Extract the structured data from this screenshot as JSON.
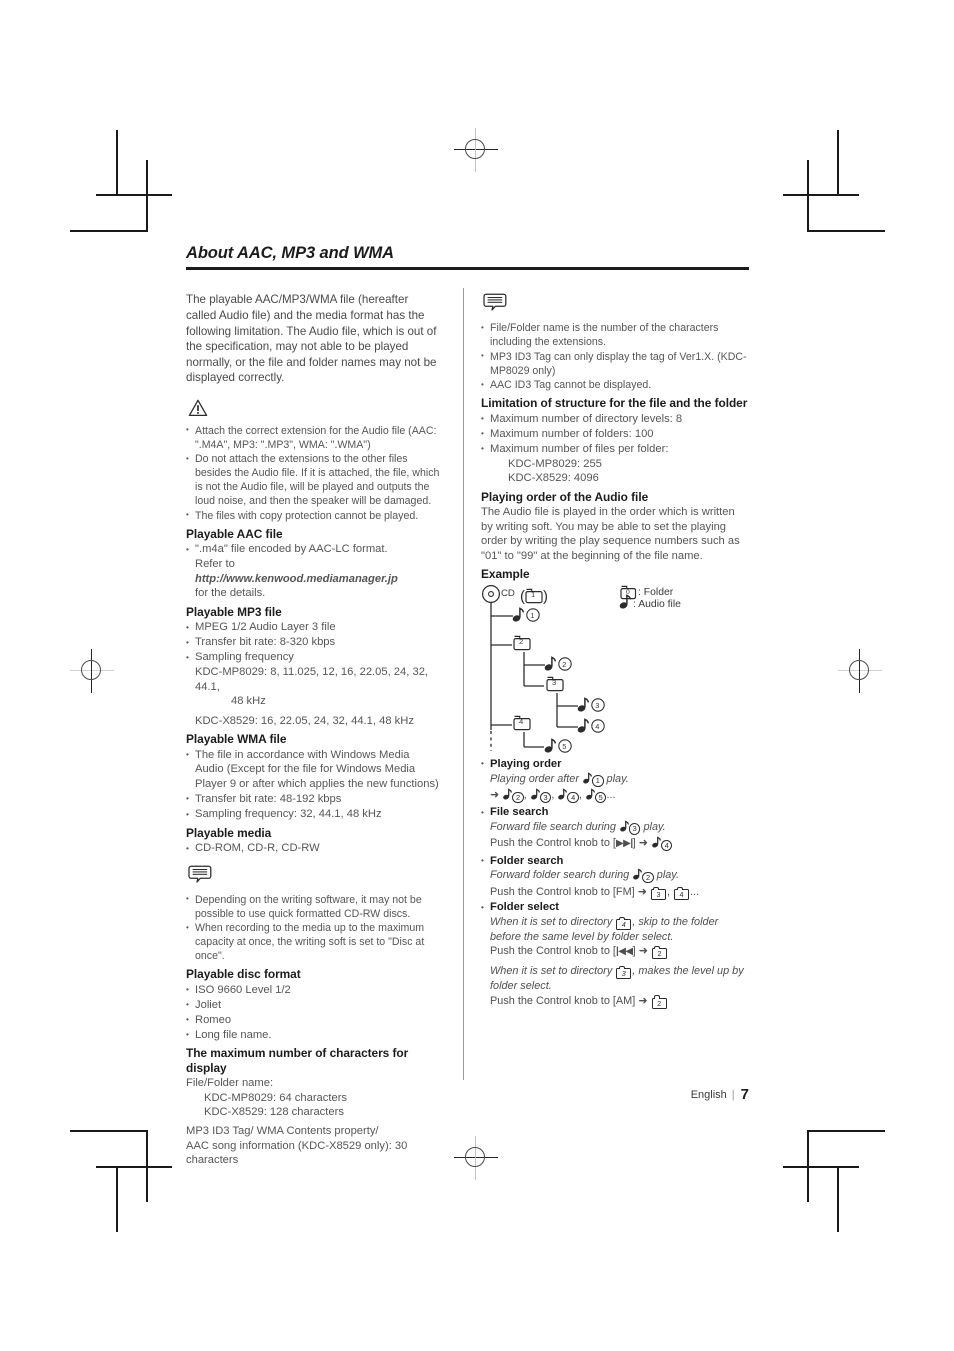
{
  "page": {
    "chapter_title": "About AAC, MP3 and WMA",
    "footer_language": "English",
    "footer_separator": "|",
    "footer_page_number": "7"
  },
  "left_column": {
    "intro": "The playable AAC/MP3/WMA file (hereafter called Audio file) and the media format has the following limitation. The Audio file, which is out of the specification, may not able to be played normally, or the file and folder names may not be displayed correctly.",
    "warning_icon": "warning-triangle-icon",
    "warning_items": [
      "Attach the correct extension for the Audio file (AAC: \".M4A\", MP3: \".MP3\", WMA: \".WMA\")",
      "Do not attach the extensions to the other files besides the Audio file. If it is attached, the file, which is not the Audio file, will be played and outputs the loud noise, and then the speaker will be damaged.",
      "The files with copy protection cannot be played."
    ],
    "aac": {
      "heading": "Playable AAC file",
      "bullet_lead": "\".m4a\" file encoded by AAC-LC format.",
      "refer_prefix": "Refer to ",
      "refer_url": "http://www.kenwood.mediamanager.jp",
      "refer_suffix": "for the details."
    },
    "mp3": {
      "heading": "Playable MP3 file",
      "items": [
        "MPEG 1/2 Audio Layer 3 file",
        "Transfer bit rate: 8-320 kbps",
        "Sampling frequency"
      ],
      "freq_line_1": "KDC-MP8029: 8, 11.025, 12, 16, 22.05, 24, 32, 44.1,",
      "freq_line_2": "48 kHz",
      "freq_line_3": "KDC-X8529: 16, 22.05, 24, 32, 44.1, 48 kHz"
    },
    "wma": {
      "heading": "Playable WMA file",
      "items": [
        "The file in accordance with Windows Media Audio (Except for the file for Windows Media Player 9 or after which applies the new functions)",
        "Transfer bit rate: 48-192 kbps",
        "Sampling frequency: 32, 44.1, 48 kHz"
      ]
    },
    "media": {
      "heading": "Playable media",
      "items": [
        "CD-ROM, CD-R, CD-RW"
      ]
    },
    "note_icon": "note-bubble-icon",
    "note_items": [
      "Depending on the writing software, it may not be possible to use quick formatted CD-RW discs.",
      "When recording to the media up to the maximum capacity at once, the writing soft is set to \"Disc at once\"."
    ],
    "disc_format": {
      "heading": "Playable disc format",
      "items": [
        "ISO 9660 Level 1/2",
        "Joliet",
        "Romeo",
        "Long file name."
      ]
    },
    "max_chars": {
      "heading": "The maximum number of characters for display",
      "line_1": "File/Folder name:",
      "indented_1": "KDC-MP8029: 64 characters",
      "indented_2": "KDC-X8529: 128 characters",
      "line_2": "MP3 ID3 Tag/ WMA Contents property/",
      "line_3": "AAC song information (KDC-X8529 only): 30",
      "line_4": "characters"
    }
  },
  "right_column": {
    "note_icon": "note-bubble-icon",
    "note_items": [
      "File/Folder name is the number of the characters including the extensions.",
      "MP3 ID3 Tag can only display the tag of Ver1.X. (KDC-MP8029 only)",
      "AAC ID3 Tag cannot be displayed."
    ],
    "limitation": {
      "heading": "Limitation of structure for the file and the folder",
      "items": [
        "Maximum number of directory levels: 8",
        "Maximum number of folders: 100",
        "Maximum number of files per folder:"
      ],
      "indented_1": "KDC-MP8029: 255",
      "indented_2": "KDC-X8529: 4096"
    },
    "playing_order": {
      "heading": "Playing order of the Audio file",
      "body": "The Audio file is played in the order which is written by writing soft. You may be able to set the playing order by writing the play sequence numbers such as \"01\" to \"99\" at the beginning of the file name.",
      "example_heading": "Example"
    },
    "diagram": {
      "root_label": "CD",
      "root_folder_number": "1",
      "legend_folder_number": "0",
      "legend_folder_text": ": Folder",
      "legend_audio_text": ": Audio file",
      "nodes": [
        {
          "kind": "audio",
          "number": "1"
        },
        {
          "kind": "folder",
          "number": "2"
        },
        {
          "kind": "audio",
          "number": "2"
        },
        {
          "kind": "folder",
          "number": "3"
        },
        {
          "kind": "audio",
          "number": "3"
        },
        {
          "kind": "audio",
          "number": "4"
        },
        {
          "kind": "folder",
          "number": "4"
        },
        {
          "kind": "audio",
          "number": "5"
        }
      ]
    },
    "operations": [
      {
        "title": "Playing order",
        "line_1_a": "Playing order after ",
        "line_1_num": "1",
        "line_1_b": " play.",
        "line_2_arrow": "➜",
        "line_2_nums": [
          "2",
          "3",
          "4",
          "5"
        ],
        "line_2_tail": "..."
      },
      {
        "title": "File search",
        "line_1_a": "Forward file search during ",
        "line_1_num": "3",
        "line_1_b": " play.",
        "line_2_a": "Push the Control knob to [",
        "line_2_key": "▶▶|",
        "line_2_b": "] ",
        "line_2_arrow": "➜",
        "line_2_num": "4"
      },
      {
        "title": "Folder search",
        "line_1_a": "Forward folder search during ",
        "line_1_num": "2",
        "line_1_b": " play.",
        "line_2_a": "Push the Control knob to [FM] ",
        "line_2_arrow": "➜",
        "line_2_folders": [
          "3",
          "4"
        ],
        "line_2_tail": "..."
      },
      {
        "title": "Folder select",
        "p1_a": "When it is set to directory ",
        "p1_folder": "4",
        "p1_b": ", skip to the folder before the same level by folder select.",
        "p1_push_a": "Push the Control knob to [",
        "p1_push_key": "|◀◀",
        "p1_push_b": "] ",
        "p1_arrow": "➜",
        "p1_folder2": "2",
        "p2_a": "When it is set to directory ",
        "p2_folder": "3",
        "p2_b": ", makes the level up by folder select.",
        "p2_push_a": "Push the Control knob to [AM] ",
        "p2_arrow": "➜",
        "p2_folder2": "2"
      }
    ]
  }
}
